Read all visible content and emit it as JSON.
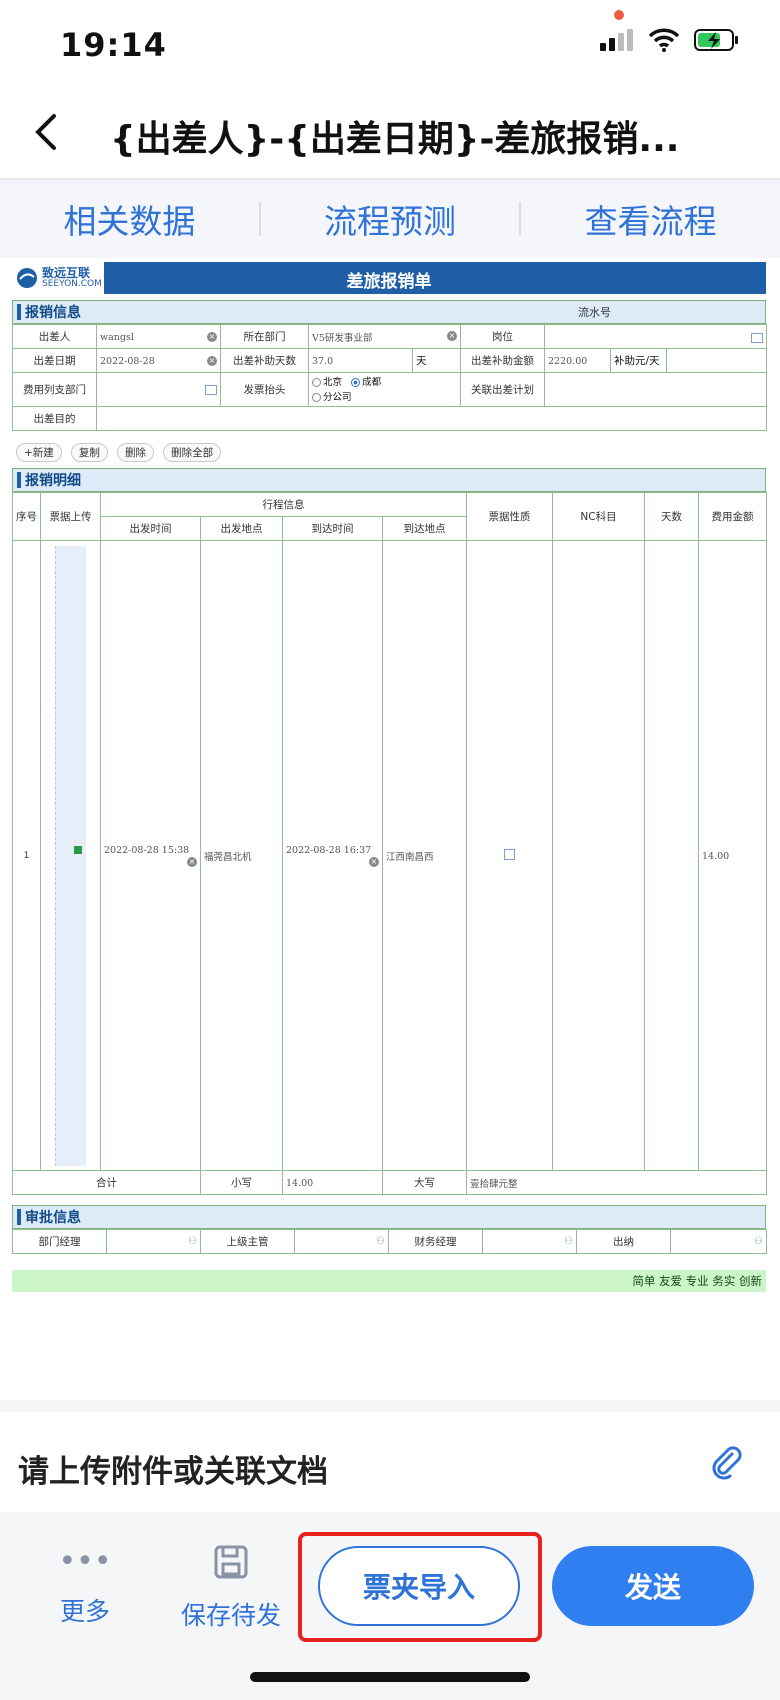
{
  "status_bar": {
    "time": "19:14"
  },
  "nav": {
    "title": "{出差人}-{出差日期}-差旅报销..."
  },
  "tabs": [
    "相关数据",
    "流程预测",
    "查看流程"
  ],
  "form": {
    "logo_cn": "致远互联",
    "logo_en": "SEEYON.COM",
    "title": "差旅报销单",
    "section_info": "报销信息",
    "serial_label": "流水号",
    "rows": {
      "traveler_label": "出差人",
      "traveler_value": "wangsl",
      "dept_label": "所在部门",
      "dept_value": "V5研发事业部",
      "post_label": "岗位",
      "date_label": "出差日期",
      "date_value": "2022-08-28",
      "days_label": "出差补助天数",
      "days_value": "37.0",
      "days_unit": "天",
      "amount_label": "出差补助金额",
      "amount_value": "2220.00",
      "rate_label": "补助元/天",
      "expense_dept_label": "费用列支部门",
      "invoice_label": "发票抬头",
      "opt1": "北京",
      "opt2": "成都",
      "opt3": "分公司",
      "plan_label": "关联出差计划",
      "purpose_label": "出差目的"
    },
    "toolbar": {
      "new": "+新建",
      "copy": "复制",
      "delete": "删除",
      "delete_all": "删除全部"
    },
    "section_detail": "报销明细",
    "detail_headers": {
      "no": "序号",
      "upload": "票据上传",
      "trip": "行程信息",
      "depart_time": "出发时间",
      "depart_place": "出发地点",
      "arrive_time": "到达时间",
      "arrive_place": "到达地点",
      "ticket": "票据性质",
      "nc": "NC科目",
      "days": "天数",
      "fee": "费用金额"
    },
    "detail_row": {
      "no": "1",
      "depart_time": "2022-08-28 15:38",
      "depart_place": "福莞昌北机",
      "arrive_time": "2022-08-28 16:37",
      "arrive_place": "江西南昌西",
      "fee": "14.00"
    },
    "totals": {
      "label": "合计",
      "small_label": "小写",
      "small_value": "14.00",
      "big_label": "大写",
      "big_value": "壹拾肆元整"
    },
    "section_approve": "审批信息",
    "approve": {
      "dept_mgr": "部门经理",
      "superior": "上级主管",
      "finance": "财务经理",
      "cashier": "出纳"
    },
    "slogan": "简单 友爱 专业 务实 创新"
  },
  "attach": {
    "text": "请上传附件或关联文档"
  },
  "bottom": {
    "more": "更多",
    "save_draft": "保存待发",
    "import": "票夹导入",
    "send": "发送"
  }
}
